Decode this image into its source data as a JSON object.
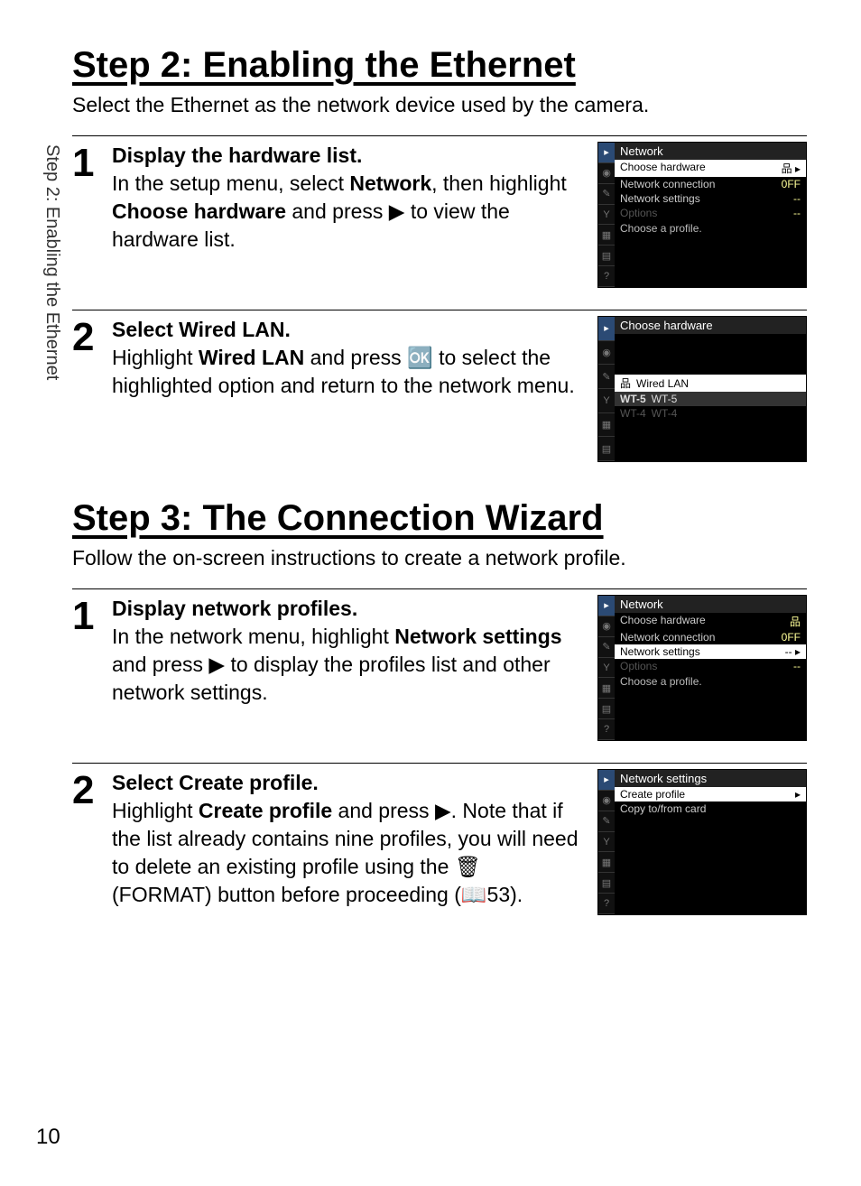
{
  "sidetab": "Step 2: Enabling the Ethernet",
  "page_number": "10",
  "glyphs": {
    "right": "▶",
    "ok": "㊙",
    "trash": "🗑",
    "format": "ꜰᴏʀᴍᴀᴛ",
    "book": "📖",
    "lan": "品"
  },
  "section2": {
    "title": "Step 2: Enabling the Ethernet",
    "intro": "Select the Ethernet as the network device used by the camera.",
    "steps": [
      {
        "num": "1",
        "heading": "Display the hardware list.",
        "body_pre": "In the setup menu, select ",
        "bold1": "Network",
        "body_mid": ", then highlight ",
        "bold2": "Choose hardware",
        "body_post": " and press ▶ to view the hardware list."
      },
      {
        "num": "2",
        "heading": "Select Wired LAN.",
        "body_pre": "Highlight ",
        "bold1": "Wired LAN",
        "body_mid": " and press 🆗 to select the highlighted option and return to the network menu.",
        "bold2": "",
        "body_post": ""
      }
    ]
  },
  "section3": {
    "title": "Step 3: The Connection Wizard",
    "intro": "Follow the on-screen instructions to create a network profile.",
    "steps": [
      {
        "num": "1",
        "heading": "Display network profiles.",
        "body_pre": "In the network menu, highlight ",
        "bold1": "Network settings",
        "body_mid": " and press ▶ to display the profiles list and other network settings.",
        "bold2": "",
        "body_post": ""
      },
      {
        "num": "2",
        "heading": "Select Create profile.",
        "body_pre": "Highlight ",
        "bold1": "Create profile",
        "body_mid": " and press ▶. Note that if the list already contains nine profiles, you will need to delete an existing profile using the 🗑 (FORMAT) button before proceeding (📖53).",
        "bold2": "",
        "body_post": ""
      }
    ]
  },
  "shots": {
    "s1": {
      "title": "Network",
      "rows": [
        {
          "label": "Choose hardware",
          "val": "品 ▸",
          "hl": true
        },
        {
          "label": "Network connection",
          "val": "0FF"
        },
        {
          "label": "Network settings",
          "val": "--"
        },
        {
          "label": "Options",
          "val": "--",
          "dim": true
        }
      ],
      "hint": "Choose a profile."
    },
    "s2": {
      "title": "Choose hardware",
      "opts": [
        {
          "icon": "品",
          "label": "Wired LAN",
          "sel": true
        },
        {
          "icon": "WT-5",
          "label": "WT-5",
          "pref": true
        },
        {
          "icon": "WT-4",
          "label": "WT-4",
          "dim": true
        }
      ]
    },
    "s3": {
      "title": "Network",
      "rows": [
        {
          "label": "Choose hardware",
          "val": "品"
        },
        {
          "label": "Network connection",
          "val": "0FF"
        },
        {
          "label": "Network settings",
          "val": "-- ▸",
          "hl": true
        },
        {
          "label": "Options",
          "val": "--",
          "dim": true
        }
      ],
      "hint": "Choose a profile."
    },
    "s4": {
      "title": "Network settings",
      "rows": [
        {
          "label": "Create profile",
          "val": "▸",
          "hl": true
        },
        {
          "label": "Copy to/from card",
          "val": ""
        }
      ]
    }
  }
}
